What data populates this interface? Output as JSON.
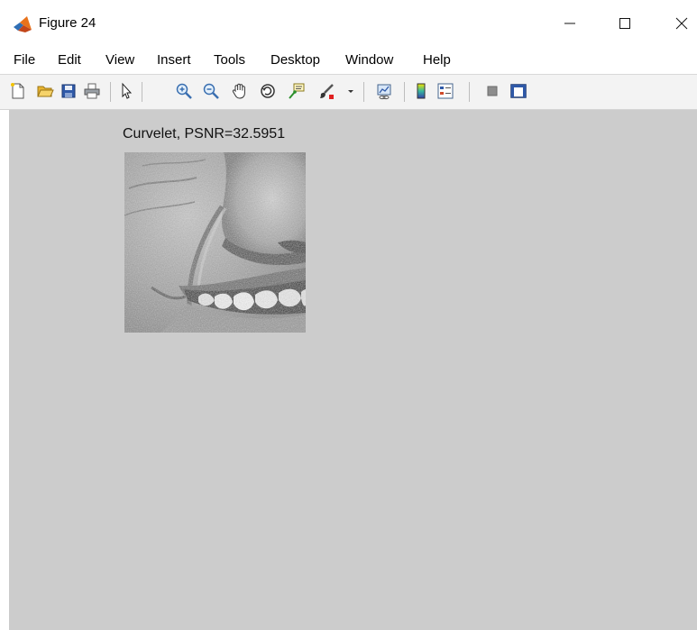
{
  "window": {
    "title": "Figure 24",
    "controls": [
      "minimize-icon",
      "maximize-icon",
      "close-icon"
    ]
  },
  "menu": {
    "items": [
      "File",
      "Edit",
      "View",
      "Insert",
      "Tools",
      "Desktop",
      "Window",
      "Help"
    ]
  },
  "toolbar": {
    "buttons": [
      "new-figure-icon",
      "open-file-icon",
      "save-icon",
      "print-icon",
      "pointer-icon",
      "zoom-in-icon",
      "zoom-out-icon",
      "pan-icon",
      "rotate-3d-icon",
      "data-cursor-icon",
      "brush-icon",
      "link-plot-icon",
      "colorbar-icon",
      "legend-icon",
      "hide-plot-tools-icon",
      "show-plot-tools-icon"
    ]
  },
  "figure": {
    "axes_title": "Curvelet, PSNR=32.5951",
    "image_subject": "grayscale close-up of a smiling face (nose and teeth)",
    "background_color": "#cccccc"
  }
}
